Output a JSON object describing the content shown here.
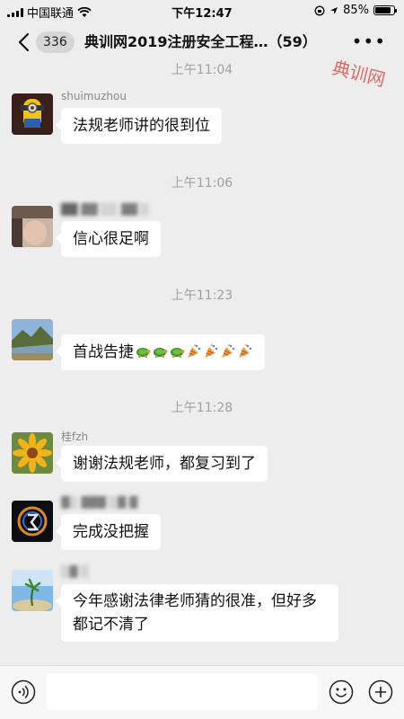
{
  "status_bar": {
    "carrier": "中国联通",
    "time": "下午12:47",
    "battery": "85%",
    "battery_level": 0.85
  },
  "nav": {
    "unread_count": "336",
    "title": "典训网2019注册安全工程…（59）"
  },
  "watermark": "典训网",
  "messages": [
    {
      "time": "上午11:04",
      "sender": "shuimuzhou",
      "text": "法规老师讲的很到位"
    },
    {
      "time": "上午11:06",
      "sender": "",
      "text": "信心很足啊"
    },
    {
      "time": "上午11:23",
      "sender": "",
      "text": "首战告捷",
      "emojis": [
        "turtle-icon",
        "turtle-icon",
        "turtle-icon",
        "party-popper-icon",
        "party-popper-icon",
        "party-popper-icon",
        "party-popper-icon"
      ]
    },
    {
      "time": "上午11:28",
      "sender": "桂fzh",
      "text": "谢谢法规老师，都复习到了"
    },
    {
      "time": "",
      "sender": "",
      "text": "完成没把握"
    },
    {
      "time": "",
      "sender": "",
      "text": "今年感谢法律老师猜的很准，但好多都记不清了"
    }
  ],
  "colors": {
    "background": "#ededed",
    "bubble": "#ffffff",
    "watermark": "#d9534f"
  }
}
